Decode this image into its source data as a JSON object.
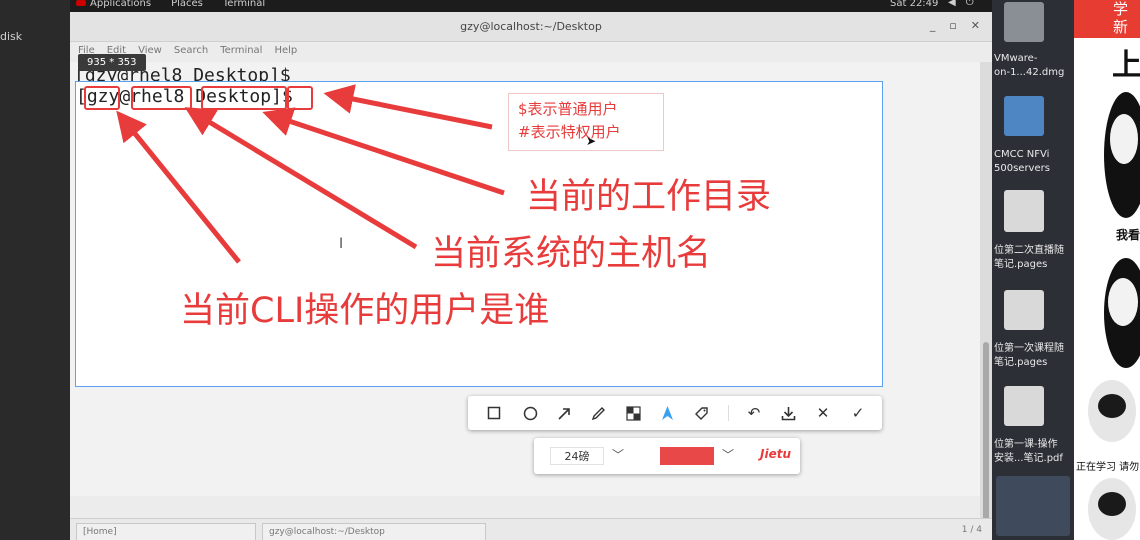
{
  "desktop_left": {
    "disk_label": "disk"
  },
  "topbar": {
    "applications": "Applications",
    "places": "Places",
    "terminal": "Terminal",
    "clock": "Sat 22:49"
  },
  "window": {
    "title": "gzy@localhost:~/Desktop",
    "menu": [
      "File",
      "Edit",
      "View",
      "Search",
      "Terminal",
      "Help"
    ],
    "prompt_line_1": "[gzy@rhel8 Desktop]$",
    "prompt_user": "gzy",
    "prompt_host": "rhel8",
    "prompt_dir": "Desktop",
    "prompt_symbol": "$",
    "taskbar": {
      "home": "[Home]",
      "terminal": "gzy@localhost:~/Desktop",
      "page": "1 / 4"
    }
  },
  "snip": {
    "size_label": "935 * 353",
    "note_line_1": "$表示普通用户",
    "note_line_2": "#表示特权用户",
    "label_directory": "当前的工作目录",
    "label_hostname": "当前系统的主机名",
    "label_user": "当前CLI操作的用户是谁",
    "toolbar_icons": [
      "rectangle-tool",
      "ellipse-tool",
      "arrow-tool",
      "pen-tool",
      "mosaic-tool",
      "text-tool",
      "tag-tool",
      "undo",
      "download",
      "cancel",
      "confirm"
    ],
    "font_size": "24磅",
    "color": "#e84848",
    "brand": "Jietu"
  },
  "desktop_right": {
    "items": [
      {
        "label_1": "VMware-",
        "label_2": "on-1...42.dmg"
      },
      {
        "label_1": "CMCC NFVi",
        "label_2": "500servers"
      },
      {
        "label_1": "位第二次直播随",
        "label_2": "笔记.pages"
      },
      {
        "label_1": "位第一次课程随",
        "label_2": "笔记.pages"
      },
      {
        "label_1": "位第一课-操作",
        "label_2": "安装...笔记.pdf"
      }
    ]
  },
  "stickers": {
    "banner_1": "学",
    "banner_2": "新",
    "big": "上",
    "caption_1": "我看",
    "caption_2": "正在学习 请勿"
  }
}
